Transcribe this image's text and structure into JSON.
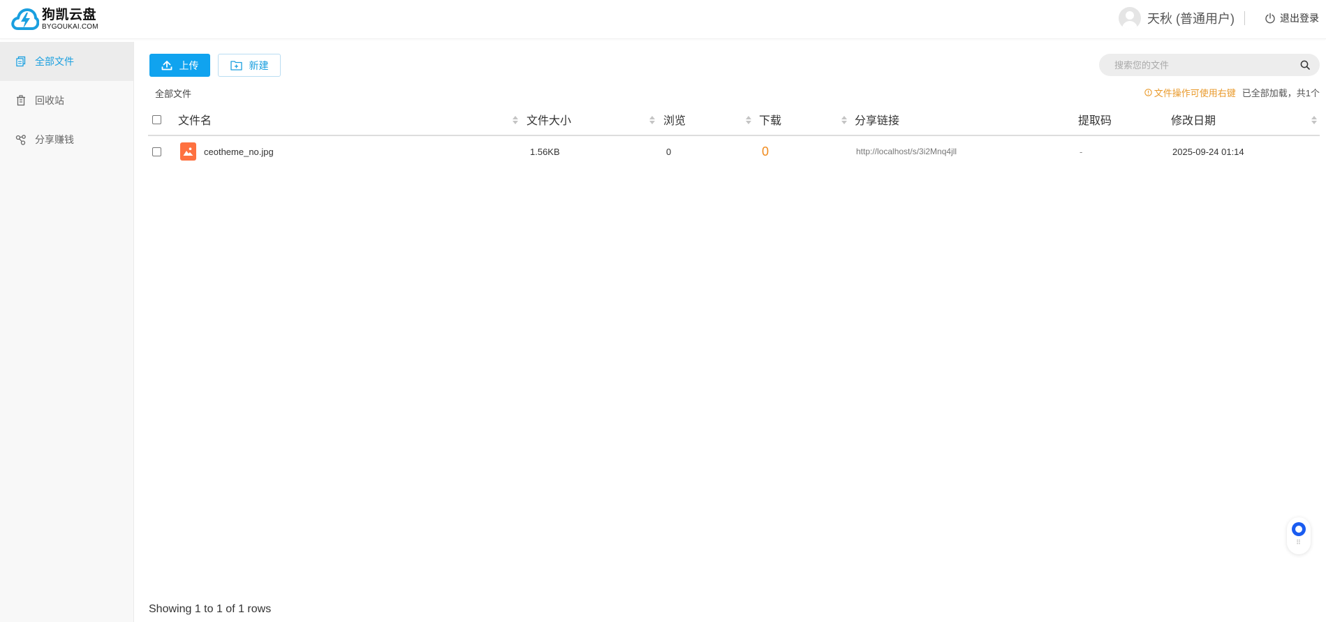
{
  "brand": {
    "name": "狗凯云盘",
    "subtitle": "BYGOUKAI.COM",
    "accent_color": "#1a9fdf"
  },
  "user": {
    "display_name": "天秋 (普通用户)",
    "logout_label": "退出登录",
    "logout_icon": "power-icon",
    "avatar_icon": "user-avatar-icon"
  },
  "sidebar": {
    "items": [
      {
        "label": "全部文件",
        "icon": "files-icon",
        "active": true
      },
      {
        "label": "回收站",
        "icon": "trash-icon",
        "active": false
      },
      {
        "label": "分享赚钱",
        "icon": "share-icon",
        "active": false
      }
    ]
  },
  "toolbar": {
    "upload_label": "上传",
    "new_label": "新建"
  },
  "search": {
    "placeholder": "搜索您的文件",
    "icon": "search-icon"
  },
  "breadcrumb": "全部文件",
  "tip": "文件操作可使用右键",
  "loaded_status": "已全部加载，共1个",
  "table": {
    "columns": [
      "文件名",
      "文件大小",
      "浏览",
      "下载",
      "分享链接",
      "提取码",
      "修改日期"
    ],
    "rows": [
      {
        "name": "ceotheme_no.jpg",
        "size": "1.56KB",
        "views": "0",
        "downloads": "0",
        "share_link": "http://localhost/s/3i2Mnq4jll",
        "code": "-",
        "modified": "2025-09-24 01:14",
        "file_type_icon": "image-file-icon"
      }
    ]
  },
  "pagination_info": "Showing 1 to 1 of 1 rows",
  "colors": {
    "primary": "#10a3ef",
    "tip": "#e99a2c",
    "download_count": "#f08a1c",
    "file_icon": "#fe7140"
  }
}
